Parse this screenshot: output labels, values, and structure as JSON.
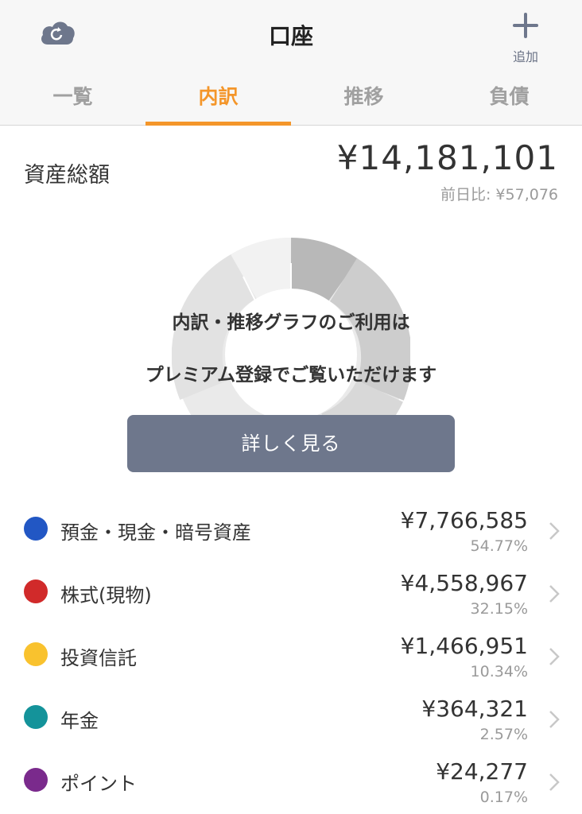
{
  "header": {
    "title": "口座",
    "add_label": "追加"
  },
  "tabs": [
    {
      "label": "一覧",
      "active": false
    },
    {
      "label": "内訳",
      "active": true
    },
    {
      "label": "推移",
      "active": false
    },
    {
      "label": "負債",
      "active": false
    }
  ],
  "summary": {
    "label": "資産総額",
    "total": "¥14,181,101",
    "diff": "前日比: ¥57,076"
  },
  "premium": {
    "line1": "内訳・推移グラフのご利用は",
    "line2": "プレミアム登録でご覧いただけます",
    "button_label": "詳しく見る"
  },
  "assets": [
    {
      "name": "預金・現金・暗号資産",
      "amount": "¥7,766,585",
      "percent": "54.77%",
      "color": "#2257c4"
    },
    {
      "name": "株式(現物)",
      "amount": "¥4,558,967",
      "percent": "32.15%",
      "color": "#d12a2a"
    },
    {
      "name": "投資信託",
      "amount": "¥1,466,951",
      "percent": "10.34%",
      "color": "#f9c22e"
    },
    {
      "name": "年金",
      "amount": "¥364,321",
      "percent": "2.57%",
      "color": "#14939a"
    },
    {
      "name": "ポイント",
      "amount": "¥24,277",
      "percent": "0.17%",
      "color": "#7a2a8c"
    }
  ],
  "colors": {
    "accent": "#f4962a",
    "button": "#6e778c"
  }
}
